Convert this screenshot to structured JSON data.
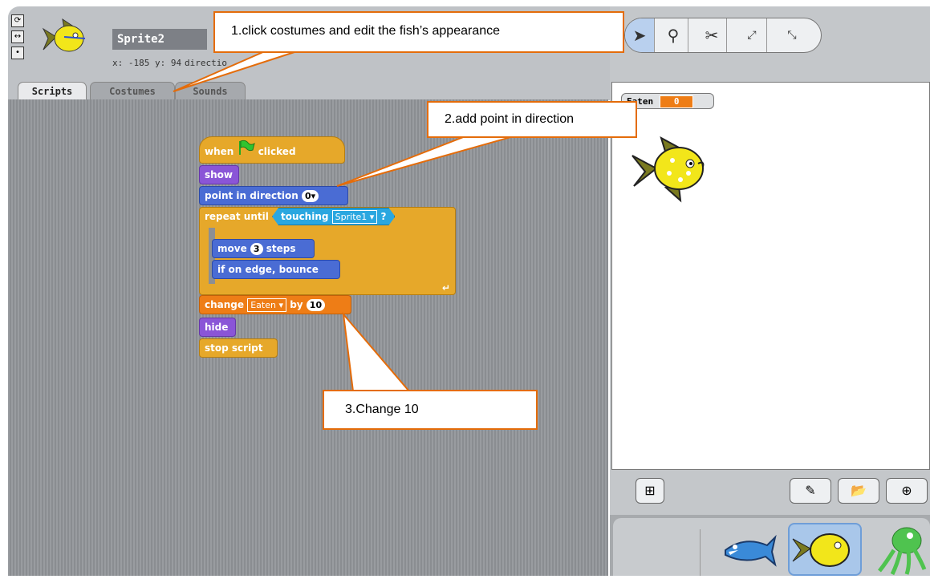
{
  "sprite": {
    "name": "Sprite2",
    "coords": "x: -185  y: 94",
    "direction_label": "directio"
  },
  "tabs": [
    "Scripts",
    "Costumes",
    "Sounds"
  ],
  "script": {
    "when_label_before": "when",
    "when_label_after": "clicked",
    "show": "show",
    "point_in_direction": "point in direction",
    "direction_value": "0",
    "repeat_until": "repeat until",
    "touching": "touching",
    "touching_target": "Sprite1",
    "question": "?",
    "move": "move",
    "move_value": "3",
    "steps": "steps",
    "bounce": "if on edge, bounce",
    "change": "change",
    "variable": "Eaten",
    "by": "by",
    "change_value": "10",
    "hide": "hide",
    "stop_script": "stop script"
  },
  "stage": {
    "monitor_label": "Eaten",
    "monitor_value": "0"
  },
  "callouts": {
    "one": "1.click costumes and edit the fish’s appearance",
    "two": "2.add point in direction",
    "three": "3.Change 10"
  },
  "colors": {
    "control": "#e6a82a",
    "looks": "#8a55d7",
    "motion": "#4a6cd4",
    "variables": "#ee7d16",
    "callout_border": "#e46c0a"
  }
}
